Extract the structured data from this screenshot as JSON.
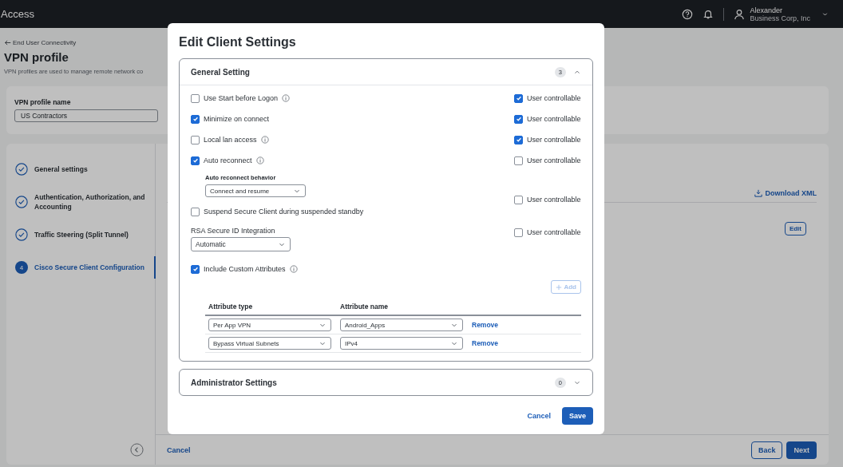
{
  "top_bar": {
    "app_title": "Access",
    "user": {
      "name": "Alexander",
      "org": "Business Corp, Inc"
    }
  },
  "page": {
    "breadcrumb": "End User Connectivity",
    "title": "VPN profile",
    "description": "VPN profiles are used to manage remote network co"
  },
  "profile_name": {
    "label": "VPN profile name",
    "value": "US Contractors"
  },
  "steps": [
    {
      "label": "General settings",
      "completed": true,
      "selected": false
    },
    {
      "label": "Authentication, Authorization, and Accounting",
      "completed": true,
      "selected": false
    },
    {
      "label": "Traffic Steering (Split Tunnel)",
      "completed": true,
      "selected": false
    },
    {
      "label": "Cisco Secure Client Configuration",
      "number": "4",
      "completed": false,
      "selected": true
    }
  ],
  "content": {
    "download_link": "Download XML",
    "edit_button": "Edit"
  },
  "footer": {
    "cancel": "Cancel",
    "back": "Back",
    "next": "Next"
  },
  "dialog": {
    "title": "Edit Client Settings",
    "sections": [
      {
        "title": "General Setting",
        "count": "3",
        "expanded": true,
        "options": [
          {
            "kind": "checkbox",
            "label": "Use Start before Logon",
            "checked": false,
            "info": true,
            "user_controllable": {
              "label": "User controllable",
              "checked": true
            }
          },
          {
            "kind": "checkbox",
            "label": "Minimize on connect",
            "checked": true,
            "info": false,
            "user_controllable": {
              "label": "User controllable",
              "checked": true
            }
          },
          {
            "kind": "checkbox",
            "label": "Local lan access",
            "checked": false,
            "info": true,
            "user_controllable": {
              "label": "User controllable",
              "checked": true
            }
          },
          {
            "kind": "checkbox",
            "label": "Auto reconnect",
            "checked": true,
            "info": true,
            "user_controllable": {
              "label": "User controllable",
              "checked": false
            }
          },
          {
            "kind": "subselect",
            "label": "Auto reconnect behavior",
            "value": "Connect and resume",
            "user_controllable": {
              "label": "User controllable",
              "checked": false
            }
          },
          {
            "kind": "checkbox",
            "label": "Suspend Secure Client during suspended standby",
            "checked": false,
            "info": false
          },
          {
            "kind": "select",
            "label": "RSA Secure ID Integration",
            "value": "Automatic",
            "user_controllable": {
              "label": "User controllable",
              "checked": false
            }
          },
          {
            "kind": "checkbox",
            "label": "Include Custom Attributes",
            "checked": true,
            "info": true
          }
        ],
        "custom_attributes": {
          "add_button": {
            "label": "Add",
            "disabled": true
          },
          "columns": [
            "Attribute type",
            "Attribute name"
          ],
          "rows": [
            {
              "type": "Per App VPN",
              "name": "Android_Apps",
              "action": "Remove"
            },
            {
              "type": "Bypass Virtual Subnets",
              "name": "IPv4",
              "action": "Remove"
            }
          ]
        }
      },
      {
        "title": "Administrator Settings",
        "count": "0",
        "expanded": false
      }
    ],
    "cancel": "Cancel",
    "save": "Save"
  }
}
